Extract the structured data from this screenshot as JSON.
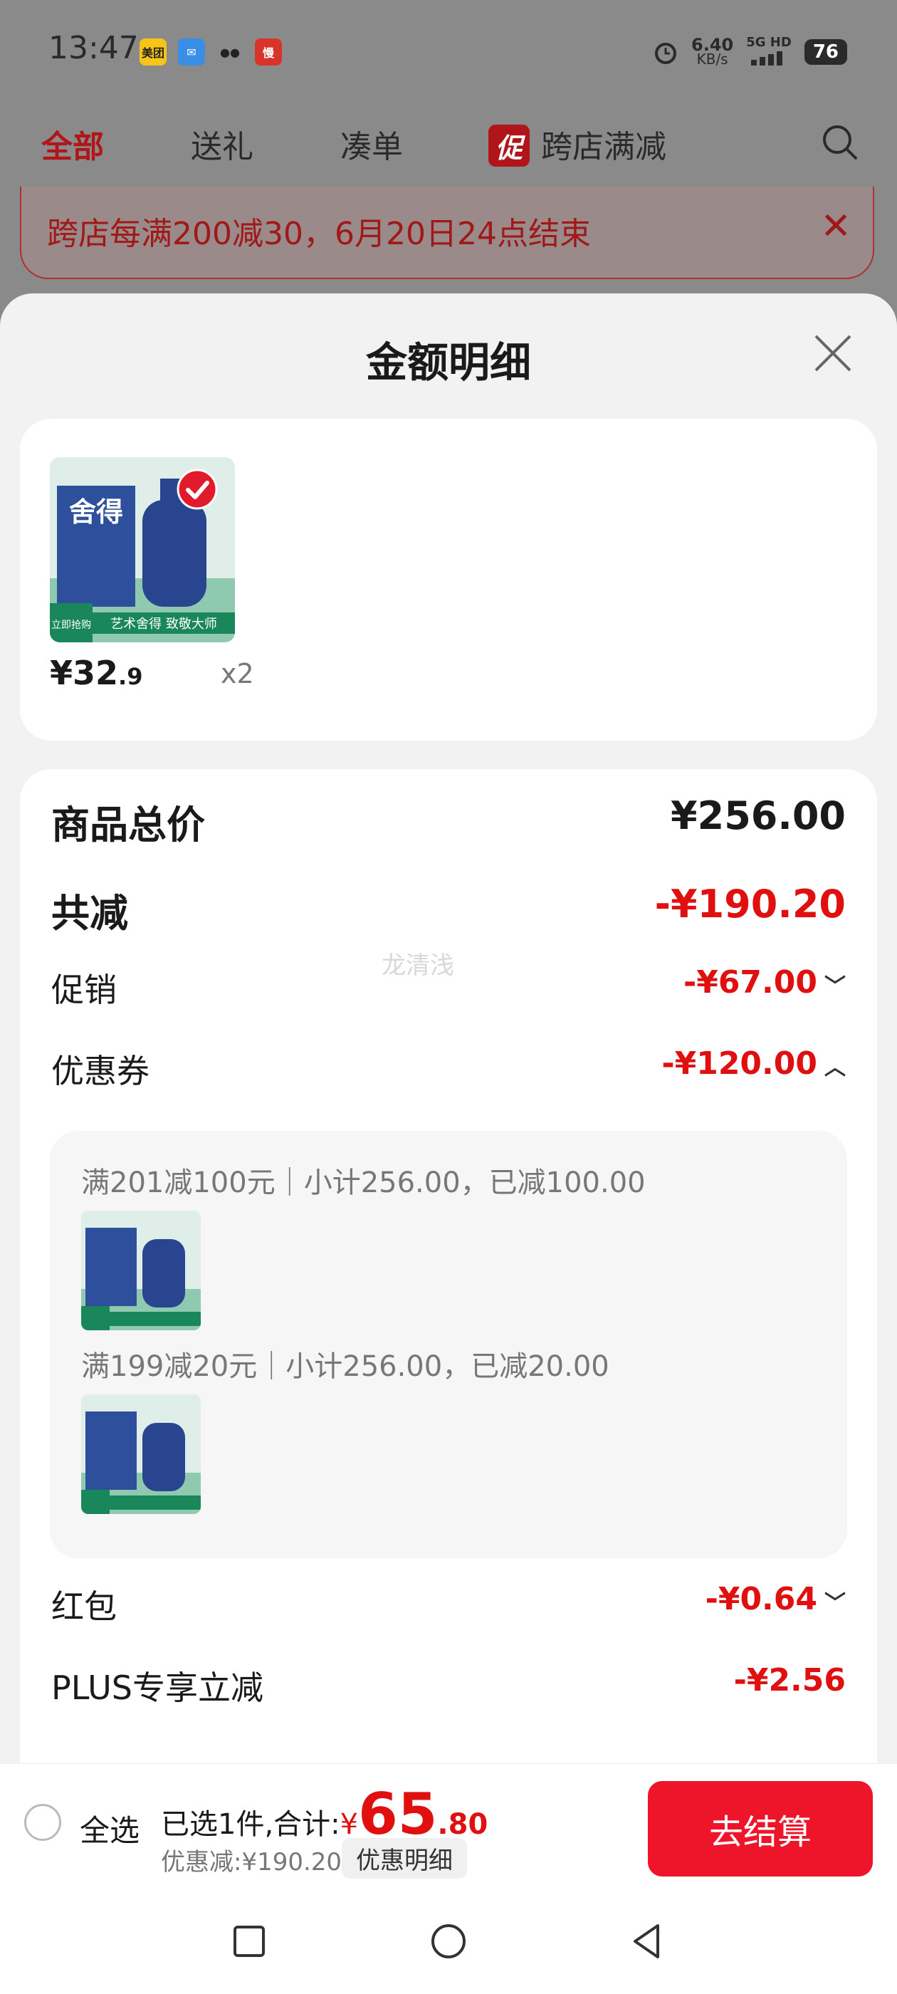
{
  "status": {
    "time": "13:47",
    "apps": [
      {
        "name": "meituan-icon",
        "label": "美团",
        "color": "#f7c518",
        "text_color": "#222"
      },
      {
        "name": "mail-icon",
        "label": "✉",
        "color": "#3a8ee6",
        "text_color": "#fff"
      },
      {
        "name": "wechat-icon",
        "label": "●●",
        "color": "#8a8a8a",
        "text_color": "#222"
      },
      {
        "name": "app-icon",
        "label": "慢",
        "color": "#d8342c",
        "text_color": "#fff"
      }
    ],
    "net_speed": "6.40",
    "net_unit": "KB/s",
    "network": "5G HD",
    "battery": "76"
  },
  "tabs": {
    "all": "全部",
    "gift": "送礼",
    "bundle": "凑单",
    "promo_badge": "促",
    "cross_store": "跨店满减"
  },
  "banner": {
    "text": "跨店每满200减30，6月20日24点结束",
    "close": "✕"
  },
  "sheet": {
    "title": "金额明细",
    "product": {
      "price_int": "¥32",
      "price_dec": ".9",
      "qty": "x2",
      "image": {
        "brand": "舍得",
        "tag": "立即抢购",
        "slogan": "艺术舍得 致敬大师"
      }
    },
    "rows": {
      "total_label": "商品总价",
      "total_value": "¥256.00",
      "reduce_label": "共减",
      "reduce_value": "-¥190.20",
      "promo_label": "促销",
      "promo_value": "-¥67.00",
      "coupon_label": "优惠券",
      "coupon_value": "-¥120.00",
      "redpacket_label": "红包",
      "redpacket_value": "-¥0.64",
      "plus_label": "PLUS专享立减",
      "plus_value": "-¥2.56"
    },
    "watermark": "龙清浅",
    "coupons": [
      {
        "text": "满201减100元｜小计256.00，已减100.00"
      },
      {
        "text": "满199减20元｜小计256.00，已减20.00"
      }
    ]
  },
  "bottom": {
    "select_all": "全选",
    "summary_prefix": "已选1件,合计:",
    "currency": "¥",
    "total_int": "65",
    "total_dec": ".80",
    "discount": "优惠减:¥190.20",
    "detail_button": "优惠明细",
    "checkout": "去结算"
  }
}
